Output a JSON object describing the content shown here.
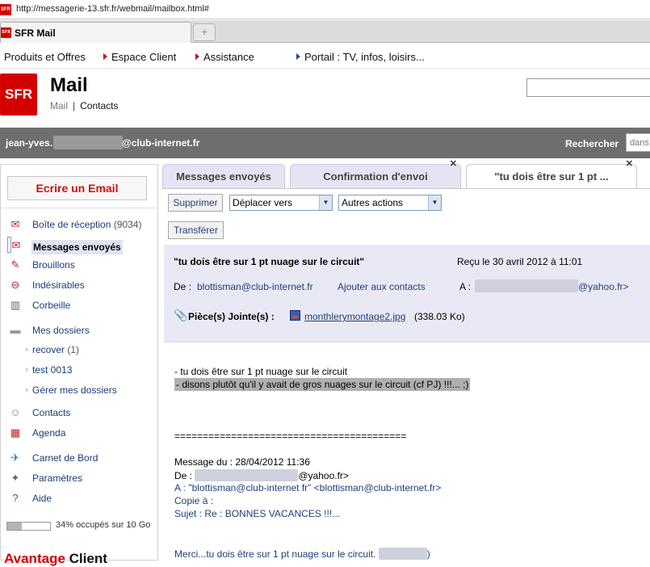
{
  "browser": {
    "url": "http://messagerie-13.sfr.fr/webmail/mailbox.html#",
    "tab_title": "SFR Mail",
    "favicon_text": "SFR"
  },
  "topnav": {
    "items": [
      "Produits et Offres",
      "Espace Client",
      "Assistance",
      "Portail : TV, infos, loisirs..."
    ]
  },
  "brand": {
    "logo_text": "SFR",
    "app_title": "Mail",
    "links": [
      "Mail",
      "Contacts"
    ],
    "separator": "|"
  },
  "userbar": {
    "user_prefix": "jean-yves.",
    "user_domain": "@club-internet.fr",
    "search_label": "Rechercher",
    "search_placeholder": "dans"
  },
  "sidebar": {
    "compose_label": "Ecrire un Email",
    "items": [
      {
        "label": "Boîte de réception",
        "count": "(9034)",
        "icon": "inbox-icon"
      },
      {
        "label": "Messages envoyés",
        "count": "",
        "icon": "sent-icon",
        "selected": true
      },
      {
        "label": "Brouillons",
        "count": "",
        "icon": "drafts-icon"
      },
      {
        "label": "Indésirables",
        "count": "",
        "icon": "spam-icon"
      },
      {
        "label": "Corbeille",
        "count": "",
        "icon": "trash-icon"
      },
      {
        "label": "Mes dossiers",
        "count": "",
        "icon": "folder-icon"
      },
      {
        "label": "recover",
        "count": "(1)",
        "icon": "bullet-icon"
      },
      {
        "label": "test 0013",
        "count": "",
        "icon": "bullet-icon"
      },
      {
        "label": "Gérer mes dossiers",
        "count": "",
        "icon": "bullet-icon"
      },
      {
        "label": "Contacts",
        "count": "",
        "icon": "contacts-icon"
      },
      {
        "label": "Agenda",
        "count": "",
        "icon": "calendar-icon"
      },
      {
        "label": "Carnet de Bord",
        "count": "",
        "icon": "logbook-icon"
      },
      {
        "label": "Paramètres",
        "count": "",
        "icon": "wrench-icon"
      },
      {
        "label": "Aide",
        "count": "",
        "icon": "help-icon"
      }
    ],
    "quota_fraction": 0.34,
    "quota_text": "34% occupés sur 10 Go",
    "promo_red": "Avantage",
    "promo_dark": "Client"
  },
  "mail_tabs": [
    {
      "label": "Messages envoyés",
      "closable": false
    },
    {
      "label": "Confirmation d'envoi",
      "closable": true
    },
    {
      "label": "\"tu dois être sur 1 pt ...",
      "closable": true,
      "active": true
    }
  ],
  "toolbar": {
    "delete_label": "Supprimer",
    "move_label": "Déplacer vers",
    "other_label": "Autres actions",
    "forward_label": "Transférer"
  },
  "message": {
    "subject": "\"tu dois être sur 1 pt nuage sur le circuit\"",
    "received": "Reçu le 30 avril 2012 à 11:01",
    "from_label": "De :",
    "from_value": "blottisman@club-internet.fr",
    "add_contact": "Ajouter aux contacts",
    "to_label": "A :",
    "to_value": "@yahoo.fr>",
    "attach_label": "Pièce(s) Jointe(s) :",
    "attach_name": "monthlerymontage2.jpg",
    "attach_size": "(338.03 Ko)",
    "body_line1": "- tu dois être sur 1 pt nuage sur le circuit",
    "body_line2": "- disons plutôt qu'il y avait de gros nuages sur le circuit (cf PJ) !!!...   ;)",
    "separator": "=========================================",
    "quoted_date": "Message du : 28/04/2012 11:36",
    "quoted_from_label": "De :",
    "quoted_from_domain": "@yahoo.fr>",
    "quoted_to": "A : \"blottisman@club-internet fr\" <blottisman@club-internet.fr>",
    "quoted_cc": "Copie à :",
    "quoted_subject": "Sujet : Re : BONNES VACANCES !!!...",
    "reply_start": "Merci...tu dois être sur 1 pt nuage sur le circuit.",
    "reply_end": ")"
  }
}
